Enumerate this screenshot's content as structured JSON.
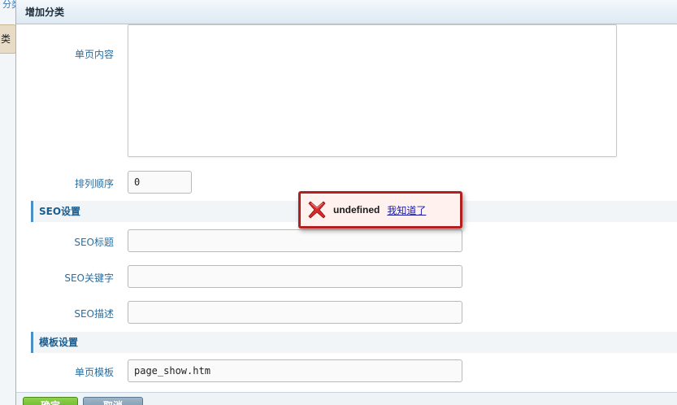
{
  "background": {
    "link_text": "分类",
    "tab_label": "类"
  },
  "dialog": {
    "title": "增加分类",
    "fields": {
      "page_content_label": "单页内容",
      "sort_order_label": "排列顺序",
      "sort_order_value": "0",
      "seo_title_label": "SEO标题",
      "seo_title_value": "",
      "seo_keywords_label": "SEO关键字",
      "seo_keywords_value": "",
      "seo_description_label": "SEO描述",
      "seo_description_value": "",
      "page_template_label": "单页模板",
      "page_template_value": "page_show.htm"
    },
    "sections": {
      "seo": "SEO设置",
      "template": "模板设置"
    },
    "buttons": {
      "ok": "确定",
      "cancel": "取消"
    }
  },
  "toast": {
    "message": "undefined",
    "link": "我知道了",
    "icon": "error-x-icon",
    "border_color": "#b02020"
  },
  "colors": {
    "label": "#2b6d9d",
    "section_title": "#1a5d8f",
    "ok_button": "#6cb52c",
    "cancel_button": "#7f99ae"
  }
}
